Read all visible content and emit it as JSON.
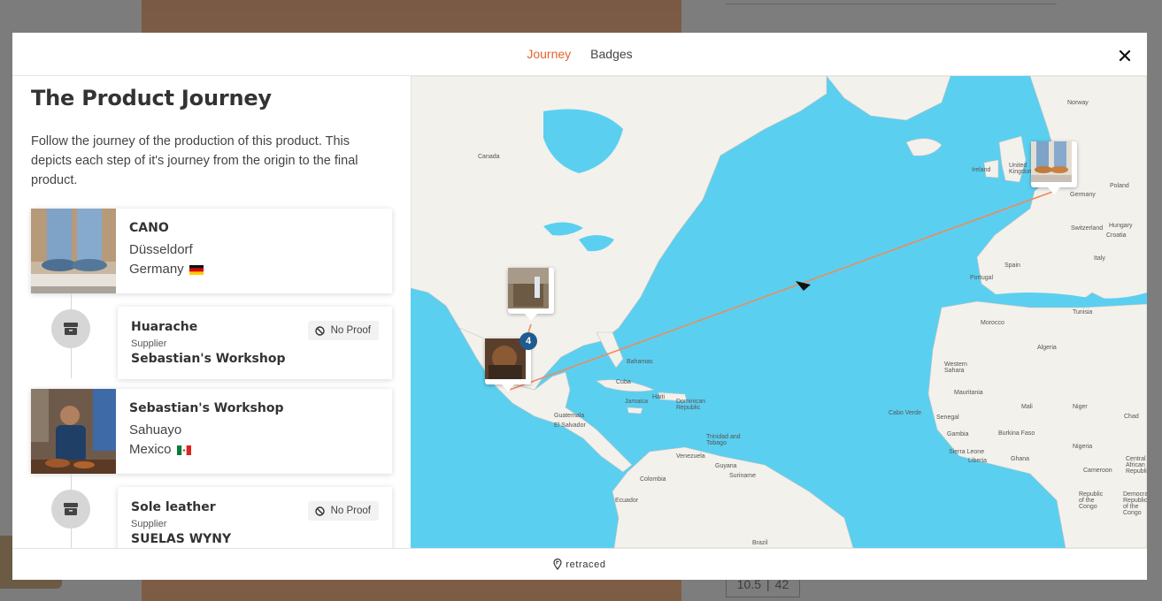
{
  "background": {
    "size_value": "10.5",
    "size_divider": "|",
    "size_eu": "42"
  },
  "tabs": [
    {
      "label": "Journey",
      "active": true
    },
    {
      "label": "Badges",
      "active": false
    }
  ],
  "left": {
    "title": "The Product Journey",
    "description": "Follow the journey of the production of this product. This depicts each step of it's journey from the origin to the final product."
  },
  "journey": {
    "cano": {
      "name": "CANO",
      "city": "Düsseldorf",
      "country": "Germany",
      "flag": "germany-flag"
    },
    "step1": {
      "name": "Huarache",
      "role": "Supplier",
      "supplier": "Sebastian's Workshop",
      "proof": "No Proof"
    },
    "sebastian": {
      "name": "Sebastian's Workshop",
      "city": "Sahuayo",
      "country": "Mexico",
      "flag": "mexico-flag"
    },
    "step2": {
      "name": "Sole leather",
      "role": "Supplier",
      "supplier": "SUELAS WYNY",
      "proof": "No Proof"
    }
  },
  "map": {
    "cluster_count": "4",
    "labels": {
      "canada": "Canada",
      "norway": "Norway",
      "uk": "United Kingdom",
      "germany": "Germany",
      "poland": "Poland",
      "ireland": "Ireland",
      "switzerland": "Switzerland",
      "croatia": "Croatia",
      "hungary": "Hungary",
      "italy": "Italy",
      "spain": "Spain",
      "portugal": "Portugal",
      "tunisia": "Tunisia",
      "morocco": "Morocco",
      "algeria": "Algeria",
      "western_sahara": "Western Sahara",
      "mauritania": "Mauritania",
      "mali": "Mali",
      "niger": "Niger",
      "chad": "Chad",
      "senegal": "Senegal",
      "burkina": "Burkina Faso",
      "nigeria": "Nigeria",
      "cameroon": "Cameroon",
      "car": "Central African Republic",
      "congo": "Republic of the Congo",
      "drc": "Democratic Republic of the Congo",
      "cape_verde": "Cabo Verde",
      "bahamas": "Bahamas",
      "cuba": "Cuba",
      "jamaica": "Jamaica",
      "haiti": "Haiti",
      "dominican": "Dominican Republic",
      "guatemala": "Guatemala",
      "el_salvador": "El Salvador",
      "venezuela": "Venezuela",
      "guyana": "Guyana",
      "suriname": "Suriname",
      "colombia": "Colombia",
      "ecuador": "Ecuador",
      "brazil": "Brazil",
      "trinidad": "Trinidad and Tobago",
      "sierra_leone": "Sierra Leone",
      "ghana": "Ghana",
      "liberia": "Liberia",
      "gambia": "Gambia"
    }
  },
  "footer": {
    "brand": "retraced"
  }
}
